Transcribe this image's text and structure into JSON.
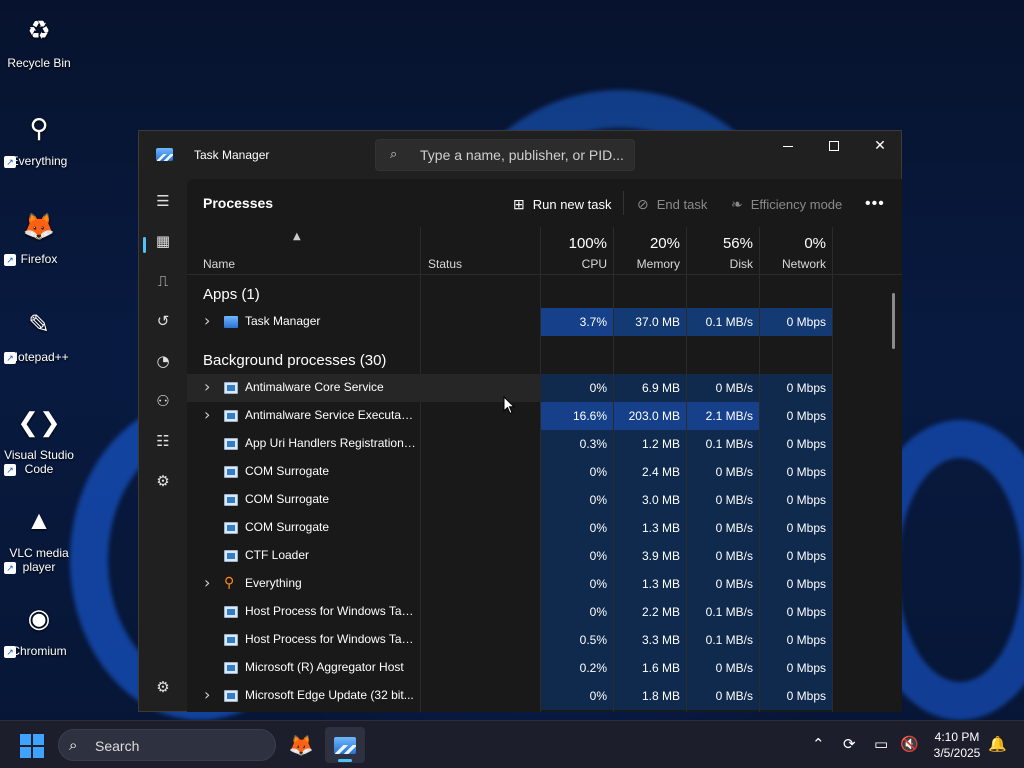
{
  "desktop": {
    "icons": [
      {
        "label": "Recycle Bin",
        "glyph": "♻",
        "bg": "#8fb5d6"
      },
      {
        "label": "Everything",
        "glyph": "⚲",
        "bg": "transparent"
      },
      {
        "label": "Firefox",
        "glyph": "🦊",
        "bg": "transparent"
      },
      {
        "label": "Notepad++",
        "glyph": "✎",
        "bg": "#cfe8b6"
      },
      {
        "label": "Visual Studio Code",
        "glyph": "❮❯",
        "bg": "transparent"
      },
      {
        "label": "VLC media player",
        "glyph": "▲",
        "bg": "transparent"
      },
      {
        "label": "Chromium",
        "glyph": "◉",
        "bg": "transparent"
      }
    ]
  },
  "window": {
    "title": "Task Manager",
    "search_placeholder": "Type a name, publisher, or PID...",
    "page_title": "Processes",
    "toolbar": {
      "run_new_task": "Run new task",
      "end_task": "End task",
      "efficiency_mode": "Efficiency mode",
      "more": "•••"
    },
    "columns": {
      "name": "Name",
      "status": "Status",
      "cpu_pct": "100%",
      "cpu": "CPU",
      "mem_pct": "20%",
      "mem": "Memory",
      "disk_pct": "56%",
      "disk": "Disk",
      "net_pct": "0%",
      "net": "Network"
    },
    "sections": {
      "apps": "Apps (1)",
      "background": "Background processes (30)"
    },
    "apps": [
      {
        "name": "Task Manager",
        "expand": true,
        "icon": "tm",
        "cpu": "3.7%",
        "mem": "37.0 MB",
        "disk": "0.1 MB/s",
        "net": "0 Mbps",
        "heat": [
          2,
          1,
          1,
          1
        ]
      }
    ],
    "background": [
      {
        "name": "Antimalware Core Service",
        "expand": true,
        "icon": "win",
        "cpu": "0%",
        "mem": "6.9 MB",
        "disk": "0 MB/s",
        "net": "0 Mbps",
        "heat": [
          0,
          0,
          0,
          0
        ]
      },
      {
        "name": "Antimalware Service Executable",
        "expand": true,
        "icon": "win",
        "cpu": "16.6%",
        "mem": "203.0 MB",
        "disk": "2.1 MB/s",
        "net": "0 Mbps",
        "heat": [
          2,
          2,
          2,
          0
        ]
      },
      {
        "name": "App Uri Handlers Registration ...",
        "expand": false,
        "icon": "win",
        "cpu": "0.3%",
        "mem": "1.2 MB",
        "disk": "0.1 MB/s",
        "net": "0 Mbps",
        "heat": [
          0,
          0,
          0,
          0
        ]
      },
      {
        "name": "COM Surrogate",
        "expand": false,
        "icon": "win",
        "cpu": "0%",
        "mem": "2.4 MB",
        "disk": "0 MB/s",
        "net": "0 Mbps",
        "heat": [
          0,
          0,
          0,
          0
        ]
      },
      {
        "name": "COM Surrogate",
        "expand": false,
        "icon": "win",
        "cpu": "0%",
        "mem": "3.0 MB",
        "disk": "0 MB/s",
        "net": "0 Mbps",
        "heat": [
          0,
          0,
          0,
          0
        ]
      },
      {
        "name": "COM Surrogate",
        "expand": false,
        "icon": "win",
        "cpu": "0%",
        "mem": "1.3 MB",
        "disk": "0 MB/s",
        "net": "0 Mbps",
        "heat": [
          0,
          0,
          0,
          0
        ]
      },
      {
        "name": "CTF Loader",
        "expand": false,
        "icon": "win",
        "cpu": "0%",
        "mem": "3.9 MB",
        "disk": "0 MB/s",
        "net": "0 Mbps",
        "heat": [
          0,
          0,
          0,
          0
        ]
      },
      {
        "name": "Everything",
        "expand": true,
        "icon": "ev",
        "cpu": "0%",
        "mem": "1.3 MB",
        "disk": "0 MB/s",
        "net": "0 Mbps",
        "heat": [
          0,
          0,
          0,
          0
        ]
      },
      {
        "name": "Host Process for Windows Tasks",
        "expand": false,
        "icon": "win",
        "cpu": "0%",
        "mem": "2.2 MB",
        "disk": "0.1 MB/s",
        "net": "0 Mbps",
        "heat": [
          0,
          0,
          0,
          0
        ]
      },
      {
        "name": "Host Process for Windows Tasks",
        "expand": false,
        "icon": "win",
        "cpu": "0.5%",
        "mem": "3.3 MB",
        "disk": "0.1 MB/s",
        "net": "0 Mbps",
        "heat": [
          0,
          0,
          0,
          0
        ]
      },
      {
        "name": "Microsoft (R) Aggregator Host",
        "expand": false,
        "icon": "win",
        "cpu": "0.2%",
        "mem": "1.6 MB",
        "disk": "0 MB/s",
        "net": "0 Mbps",
        "heat": [
          0,
          0,
          0,
          0
        ]
      },
      {
        "name": "Microsoft Edge Update (32 bit...",
        "expand": true,
        "icon": "win",
        "cpu": "0%",
        "mem": "1.8 MB",
        "disk": "0 MB/s",
        "net": "0 Mbps",
        "heat": [
          0,
          0,
          0,
          0
        ]
      }
    ]
  },
  "taskbar": {
    "search_label": "Search",
    "time": "4:10 PM",
    "date": "3/5/2025"
  },
  "colors": {
    "accent": "#4cc2ff",
    "heat_low": "#102a4e",
    "heat_mid": "#133a72",
    "heat_high": "#16418a"
  }
}
